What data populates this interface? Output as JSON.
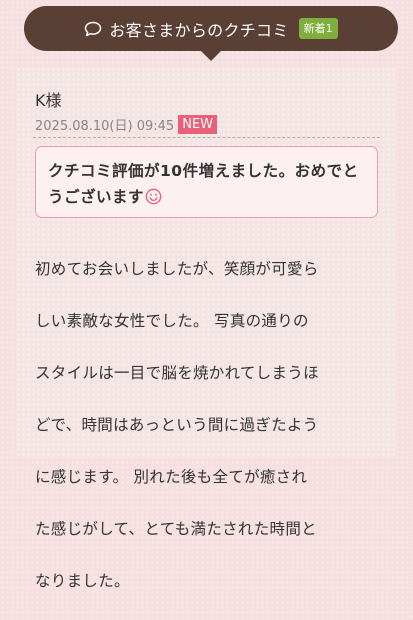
{
  "header": {
    "icon": "speech-bubble-icon",
    "title": "お客さまからのクチコミ",
    "new_badge": "新着1",
    "colors": {
      "background": "#5a3f34",
      "badge": "#7fae3d"
    }
  },
  "review": {
    "reviewer": "K様",
    "date": "2025.08.10(日) 09:45",
    "new_label": "NEW",
    "announcement": "クチコミ評価が10件増えました。おめでとうございます",
    "announcement_icon": "smile-icon",
    "body_lines": [
      "初めてお会いしましたが、笑顔が可愛ら",
      "しい素敵な女性でした。 写真の通りの",
      "スタイルは一目で脳を焼かれてしまうほ",
      "どで、時間はあっという間に過ぎたよう",
      "に感じます。 別れた後も全てが癒され",
      "た感じがして、とても満たされた時間と",
      "なりました。"
    ],
    "colors": {
      "new_badge": "#e8607a",
      "box_border": "#ef9bab"
    }
  }
}
